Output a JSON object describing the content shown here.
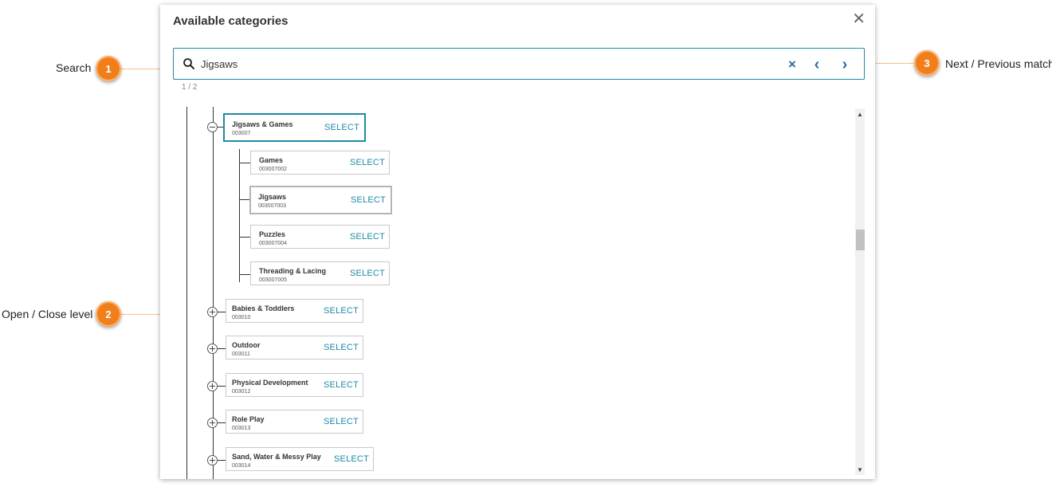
{
  "callouts": [
    {
      "number": "1",
      "label": "Search"
    },
    {
      "number": "2",
      "label": "Open / Close level"
    },
    {
      "number": "3",
      "label": "Next / Previous match"
    }
  ],
  "dialog": {
    "title": "Available categories",
    "close_icon": "close-icon"
  },
  "search": {
    "value": "Jigsaws",
    "match_count": "1 / 2",
    "clear_glyph": "×",
    "prev_glyph": "‹",
    "next_glyph": "›"
  },
  "select_label": "SELECT",
  "tree": {
    "expanded_node": {
      "name": "Jigsaws & Games",
      "code": "003007"
    },
    "children": [
      {
        "name": "Games",
        "code": "003007002"
      },
      {
        "name": "Jigsaws",
        "code": "003007003"
      },
      {
        "name": "Puzzles",
        "code": "003007004"
      },
      {
        "name": "Threading & Lacing",
        "code": "003007005"
      }
    ],
    "siblings": [
      {
        "name": "Babies & Toddlers",
        "code": "003010"
      },
      {
        "name": "Outdoor",
        "code": "003011"
      },
      {
        "name": "Physical Development",
        "code": "003012"
      },
      {
        "name": "Role Play",
        "code": "003013"
      },
      {
        "name": "Sand, Water & Messy Play",
        "code": "003014"
      }
    ]
  },
  "colors": {
    "accent": "#1e8aa6",
    "callout": "#f07f1b"
  }
}
